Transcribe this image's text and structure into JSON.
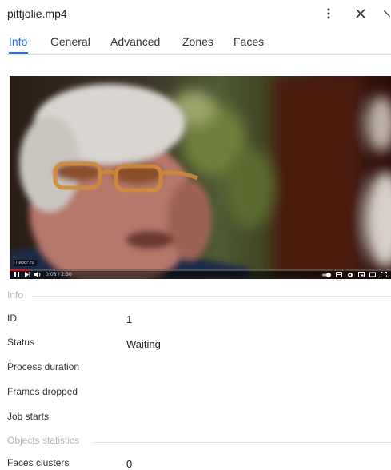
{
  "window": {
    "title": "pittjolie.mp4"
  },
  "header": {
    "more_icon": "more-vertical-icon",
    "close_icon": "close-icon",
    "extra_icon": "chevron-icon"
  },
  "tabs": [
    {
      "label": "Info",
      "active": true
    },
    {
      "label": "General",
      "active": false
    },
    {
      "label": "Advanced",
      "active": false
    },
    {
      "label": "Zones",
      "active": false
    },
    {
      "label": "Faces",
      "active": false
    }
  ],
  "video": {
    "watermark": "Пирог.ru",
    "time": "0:08 / 2:30",
    "progress": 0.053,
    "controls_icons": [
      "play-pause-icon",
      "next-icon",
      "volume-icon",
      "autoplay-toggle-icon",
      "subtitles-icon",
      "settings-icon",
      "miniplayer-icon",
      "theater-mode-icon",
      "fullscreen-icon"
    ]
  },
  "info": {
    "section_title": "Info",
    "fields": [
      {
        "label": "ID",
        "value": "1"
      },
      {
        "label": "Status",
        "value": "Waiting"
      },
      {
        "label": "Process duration",
        "value": ""
      },
      {
        "label": "Frames dropped",
        "value": ""
      },
      {
        "label": "Job starts",
        "value": ""
      }
    ]
  },
  "objects_statistics": {
    "section_title": "Objects statistics",
    "fields": [
      {
        "label": "Faces clusters",
        "value": "0"
      }
    ]
  },
  "colors": {
    "accent": "#1a73e8",
    "divider": "#e3e3e3",
    "section_text": "#b6b6b6"
  }
}
